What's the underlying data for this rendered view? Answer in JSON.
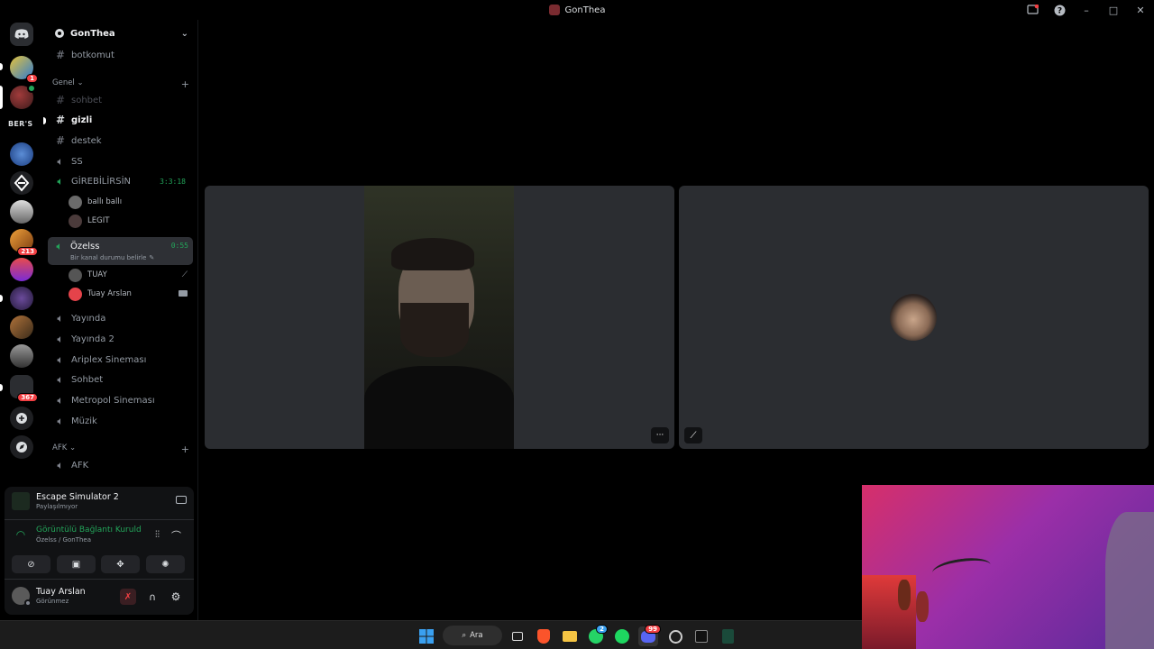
{
  "window": {
    "title": "GonThea"
  },
  "server_rail": {
    "home_icon": "discord-icon",
    "badges": {
      "first": "1",
      "s7": "213",
      "s12": "367"
    },
    "server_text": "BER'S"
  },
  "sidebar": {
    "server_name": "GonThea",
    "top_channel": "botkomut",
    "category_genel": "Genel",
    "channels": {
      "sohbet": "sohbet",
      "gizli": "gizli",
      "destek": "destek",
      "ss": "SS",
      "girebilirsin": "GİREBİLİRSİN",
      "ozelss": "Özelss",
      "yayinda": "Yayında",
      "yayinda2": "Yayında 2",
      "ariplex": "Ariplex Sineması",
      "sohbet_voice": "Sohbet",
      "metropol": "Metropol Sineması",
      "muzik": "Müzik",
      "afk": "AFK"
    },
    "girebilirsin_timer": "3:3:18",
    "ozelss_timer": "0:55",
    "ozelss_status": "Bir kanal durumu belirle",
    "voice_users": {
      "balli": "ballı ballı",
      "legit": "LEGIT",
      "tuay": "TUAY",
      "tuay_arslan": "Tuay Arslan"
    },
    "category_afk": "AFK"
  },
  "panel": {
    "activity_title": "Escape Simulator 2",
    "activity_sub": "Paylaşılmıyor",
    "voice_status": "Görüntülü Bağlantı Kuruldu",
    "voice_channel": "Özelss / GonThea",
    "username": "Tuay Arslan",
    "user_status": "Görünmez"
  },
  "video": {
    "more_label": "···"
  },
  "taskbar": {
    "search_label": "Ara",
    "whatsapp_badge": "2",
    "discord_badge": "99"
  },
  "colors": {
    "accent_green": "#23a55a",
    "badge_red": "#f23f43",
    "tile_bg": "#2b2d31"
  }
}
